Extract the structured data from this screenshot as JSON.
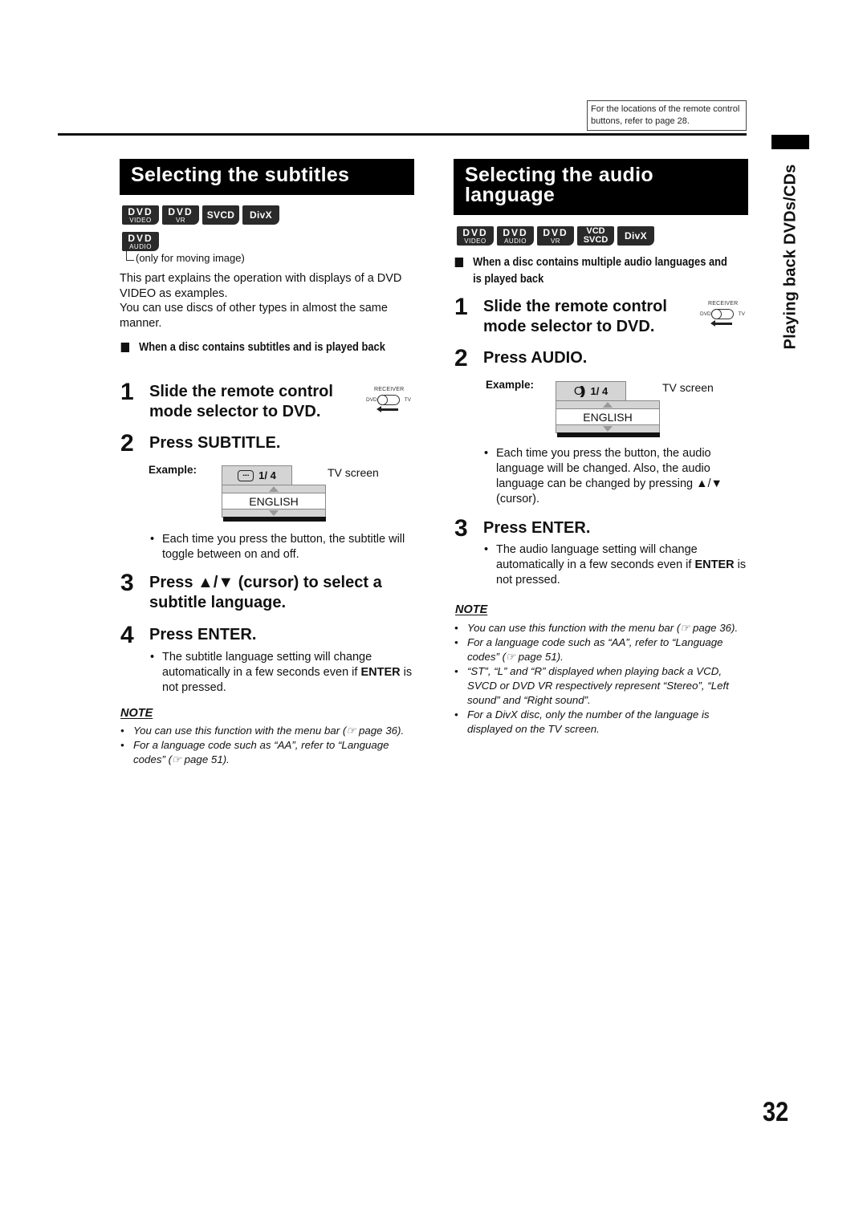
{
  "header": {
    "reference_note": "For the locations of the remote control buttons, refer to page 28.",
    "side_tab": "Playing back DVDs/CDs"
  },
  "left_section": {
    "title": "Selecting the subtitles",
    "badges_row1": [
      {
        "top": "DVD",
        "bottom": "VIDEO"
      },
      {
        "top": "DVD",
        "bottom": "VR"
      },
      {
        "single": "SVCD"
      },
      {
        "single": "DivX"
      }
    ],
    "badges_row2": [
      {
        "top": "DVD",
        "bottom": "AUDIO"
      }
    ],
    "badge_note": "(only for moving image)",
    "intro_lines": [
      "This part explains the operation with displays of a DVD VIDEO as examples.",
      "You can use discs of other types in almost the same manner."
    ],
    "subheading": "When a disc contains subtitles and is played back",
    "steps": [
      {
        "num": "1",
        "text": "Slide the remote control mode selector to DVD."
      },
      {
        "num": "2",
        "text": "Press SUBTITLE."
      },
      {
        "num": "3",
        "text": "Press ▲/▼ (cursor) to select a subtitle language."
      },
      {
        "num": "4",
        "text": "Press ENTER."
      }
    ],
    "example": {
      "label": "Example:",
      "counter": "1/ 4",
      "icon": "subtitle-icon",
      "language": "ENGLISH",
      "tv_label": "TV screen"
    },
    "step2_bullet": "Each time you press the button, the subtitle will toggle between on and off.",
    "step4_bullet_bold": "ENTER",
    "step4_bullet_pre": "The subtitle language setting will change automatically in a few seconds even if ",
    "step4_bullet_post": " is not pressed.",
    "note_title": "NOTE",
    "notes": [
      "You can use this function with the menu bar (☞ page 36).",
      "For a language code such as “AA”, refer to “Language codes” (☞ page 51)."
    ]
  },
  "right_section": {
    "title": "Selecting the audio language",
    "badges": [
      {
        "top": "DVD",
        "bottom": "VIDEO"
      },
      {
        "top": "DVD",
        "bottom": "AUDIO"
      },
      {
        "top": "DVD",
        "bottom": "VR"
      },
      {
        "top": "VCD",
        "bottom": "SVCD"
      },
      {
        "single": "DivX"
      }
    ],
    "subheading": "When a disc contains multiple audio languages and is played back",
    "steps": [
      {
        "num": "1",
        "text": "Slide the remote control mode selector to DVD."
      },
      {
        "num": "2",
        "text": "Press AUDIO."
      },
      {
        "num": "3",
        "text": "Press ENTER."
      }
    ],
    "example": {
      "label": "Example:",
      "counter": "1/ 4",
      "icon": "audio-icon",
      "language": "ENGLISH",
      "tv_label": "TV screen"
    },
    "step2_bullet": "Each time you press the button, the audio language will be changed. Also, the audio language can be changed by pressing ▲/▼ (cursor).",
    "step3_bullet_pre": "The audio language setting will change automatically in a few seconds even if ",
    "step3_bullet_bold": "ENTER",
    "step3_bullet_post": " is not pressed.",
    "note_title": "NOTE",
    "notes": [
      "You can use this function with the menu bar (☞ page 36).",
      "For a language code such as “AA”, refer to “Language codes” (☞ page 51).",
      "“ST”, “L” and “R” displayed when playing back a VCD, SVCD or DVD VR respectively represent “Stereo”, “Left sound” and “Right sound”.",
      "For a DivX disc, only the number of the language is displayed on the TV screen."
    ]
  },
  "selector": {
    "top_label": "RECEIVER",
    "left_label": "DVD",
    "right_label": "TV"
  },
  "bullet_glyph": "•",
  "page_number": "32"
}
